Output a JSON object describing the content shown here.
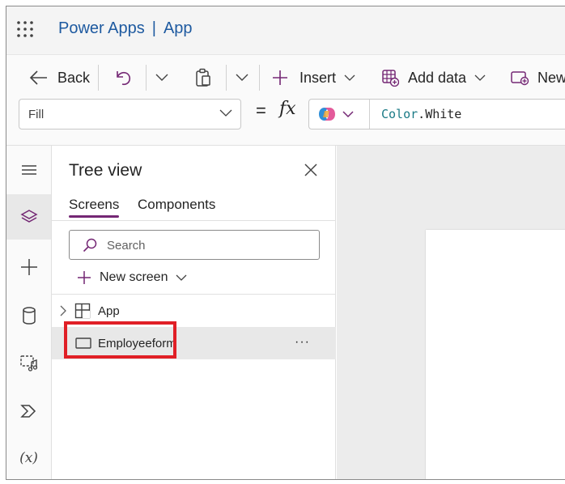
{
  "app": {
    "product": "Power Apps",
    "separator": "|",
    "name": "App"
  },
  "toolbar": {
    "back_label": "Back",
    "insert_label": "Insert",
    "add_data_label": "Add data",
    "new_label": "New"
  },
  "formula_bar": {
    "property": "Fill",
    "equals": "=",
    "fx": "fx",
    "formula_object": "Color",
    "formula_dot": ".",
    "formula_property": "White"
  },
  "left_rail": {
    "items": [
      "menu-icon",
      "layers-icon",
      "add-icon",
      "database-icon",
      "media-icon",
      "power-automate-icon",
      "variables-icon"
    ],
    "variables_label": "(x)"
  },
  "tree_view": {
    "title": "Tree view",
    "tabs": [
      {
        "label": "Screens",
        "active": true
      },
      {
        "label": "Components",
        "active": false
      }
    ],
    "search_placeholder": "Search",
    "new_screen_label": "New screen",
    "items": [
      {
        "label": "App",
        "icon": "app-icon",
        "expandable": true,
        "selected": false
      },
      {
        "label": "Employeeform",
        "icon": "screen-icon",
        "expandable": false,
        "selected": true,
        "more": "···"
      }
    ]
  },
  "colors": {
    "brand_blue": "#1e5aa0",
    "accent_purple": "#742774",
    "highlight_red": "#e01f26",
    "formula_object": "#1a7a86"
  }
}
